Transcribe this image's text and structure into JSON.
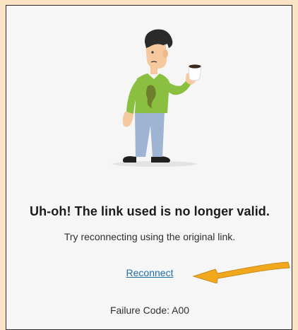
{
  "error": {
    "headline": "Uh-oh! The link used is no longer valid.",
    "message": "Try reconnecting using the original link.",
    "reconnect_label": "Reconnect",
    "failure_code": "Failure Code: A00"
  },
  "icons": {
    "illustration": "confused-person-with-coffee-illustration",
    "arrow": "arrow-pointing-left-icon"
  },
  "colors": {
    "page_background": "#fbe4c6",
    "panel_background": "#f6f6f6",
    "link": "#1f6ea8",
    "arrow": "#f2a81d",
    "sweater": "#8bbf3f",
    "pants": "#9fb4d2"
  }
}
